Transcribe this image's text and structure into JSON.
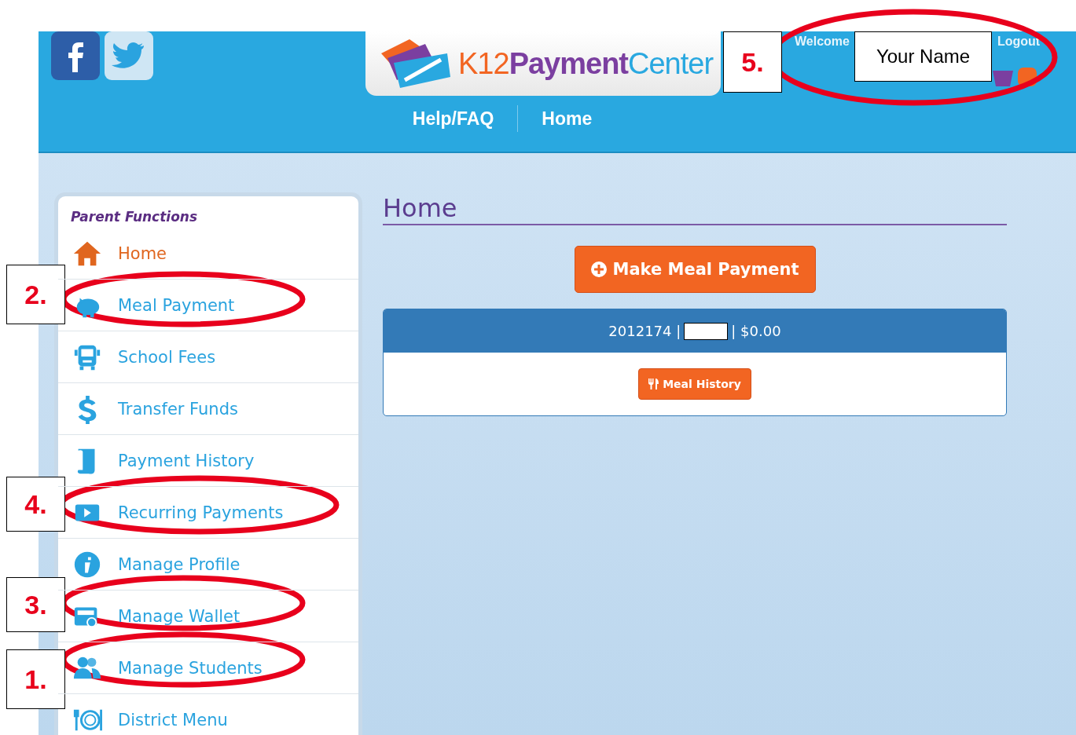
{
  "header": {
    "logo": [
      "K12",
      "Payment",
      "Center"
    ],
    "welcome": "Welcome",
    "logout": "Logout",
    "nav": [
      {
        "label": "Help/FAQ"
      },
      {
        "label": "Home"
      }
    ]
  },
  "sidebar": {
    "title": "Parent Functions",
    "items": [
      {
        "label": "Home",
        "kind": "home",
        "selected": true
      },
      {
        "label": "Meal Payment",
        "kind": "piggy",
        "selected": false
      },
      {
        "label": "School Fees",
        "kind": "bus",
        "selected": false
      },
      {
        "label": "Transfer Funds",
        "kind": "dollar",
        "selected": false
      },
      {
        "label": "Payment History",
        "kind": "scroll",
        "selected": false
      },
      {
        "label": "Recurring Payments",
        "kind": "play",
        "selected": false
      },
      {
        "label": "Manage Profile",
        "kind": "info",
        "selected": false
      },
      {
        "label": "Manage Wallet",
        "kind": "wallet",
        "selected": false
      },
      {
        "label": "Manage Students",
        "kind": "users",
        "selected": false
      },
      {
        "label": "District Menu",
        "kind": "dining",
        "selected": false
      }
    ]
  },
  "main": {
    "title": "Home",
    "pay_button": "Make Meal Payment",
    "card": {
      "id": "2012174 |",
      "balance": "| $0.00",
      "history_button": "Meal History"
    }
  },
  "annotations": {
    "name_box": "Your Name",
    "callouts": [
      {
        "label": "5."
      },
      {
        "label": "2."
      },
      {
        "label": "4."
      },
      {
        "label": "3."
      },
      {
        "label": "1."
      }
    ]
  }
}
